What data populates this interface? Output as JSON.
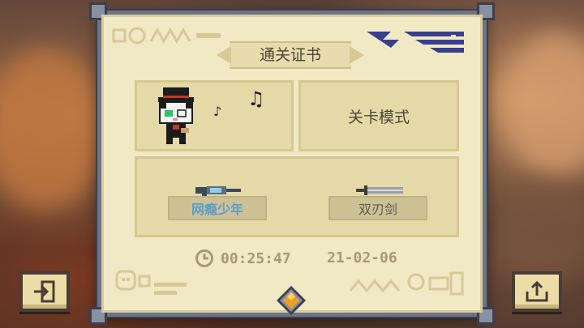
{
  "certificate": {
    "title": "通关证书",
    "mode_label": "关卡模式",
    "character": {
      "icon": "cat-gentleman-icon",
      "notes_icon": "music-note-icon"
    },
    "weapons": [
      {
        "name": "网瘾少年",
        "icon": "gun-icon",
        "color": "#5b9fc8"
      },
      {
        "name": "双刃剑",
        "icon": "double-sword-icon",
        "color": "#5e5a4a"
      }
    ],
    "time": "00:25:47",
    "date": "21-02-06"
  },
  "buttons": {
    "exit_icon": "exit-icon",
    "share_icon": "share-icon"
  },
  "colors": {
    "paper": "#f1e8c4",
    "frame": "#6e7487",
    "panel": "#e6d9a8",
    "accent_blue": "#3a3f8c"
  }
}
